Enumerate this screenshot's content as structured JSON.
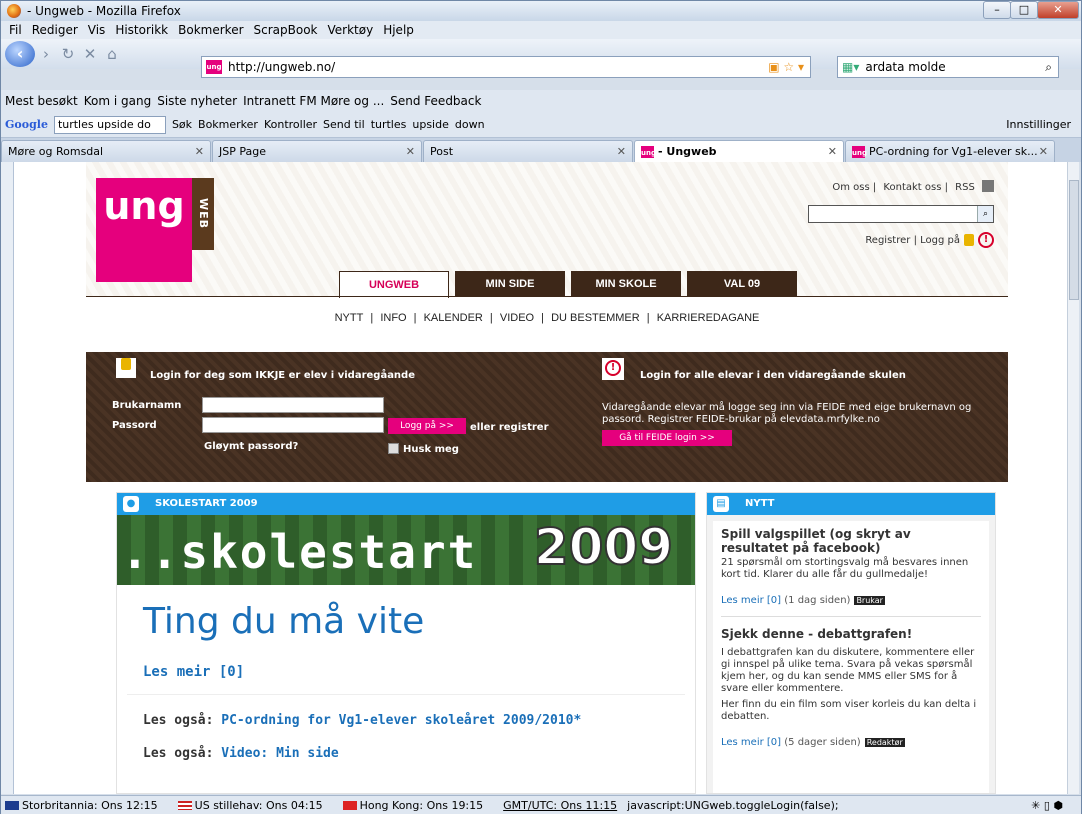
{
  "window": {
    "title": "- Ungweb - Mozilla Firefox"
  },
  "menu": [
    "Fil",
    "Rediger",
    "Vis",
    "Historikk",
    "Bokmerker",
    "ScrapBook",
    "Verktøy",
    "Hjelp"
  ],
  "url": "http://ungweb.no/",
  "search": {
    "value": "ardata molde"
  },
  "bookmarks": [
    "Mest besøkt",
    "Kom i gang",
    "Siste nyheter",
    "Intranett FM Møre og ...",
    "Send Feedback"
  ],
  "googlebar": {
    "logo": "Google",
    "query": "turtles upside do",
    "items": [
      "Søk",
      "Bokmerker",
      "Kontroller",
      "Send til",
      "turtles",
      "upside",
      "down"
    ],
    "settings": "Innstillinger"
  },
  "tabs": [
    {
      "label": "Møre og Romsdal",
      "active": false
    },
    {
      "label": "JSP Page",
      "active": false
    },
    {
      "label": "Post",
      "active": false
    },
    {
      "label": "- Ungweb",
      "active": true
    },
    {
      "label": "PC-ordning for Vg1-elever sk...",
      "active": false
    }
  ],
  "site": {
    "logo": "ung",
    "logo_side": "WEB",
    "toplinks": [
      "Om oss",
      "Kontakt oss",
      "RSS"
    ],
    "register": "Registrer",
    "login": "Logg på",
    "main_tabs": [
      "UNGWEB",
      "MIN SIDE",
      "MIN SKOLE",
      "VAL 09"
    ],
    "subnav": [
      "NYTT",
      "INFO",
      "KALENDER",
      "VIDEO",
      "DU BESTEMMER",
      "KARRIEREDAGANE"
    ],
    "login_left": {
      "title": "Login for deg som IKKJE er elev i vidaregåande",
      "user_label": "Brukarnamn",
      "pass_label": "Passord",
      "button": "Logg på >>",
      "or_register": "eller registrer",
      "forgot": "Gløymt passord?",
      "remember": "Husk meg"
    },
    "login_right": {
      "title": "Login for alle elevar i den vidaregåande skulen",
      "text": "Vidaregåande elevar må logge seg inn via FEIDE med eige brukernavn og passord. Registrer FEIDE-brukar på elevdata.mrfylke.no",
      "button": "Gå til FEIDE login >>"
    },
    "section": {
      "title": "SKOLESTART 2009",
      "banner_text": "..skolestart",
      "banner_year": "2009",
      "heading": "Ting du må vite",
      "read_more": "Les meir [0]",
      "also_label": "Les også:",
      "also": [
        "PC-ordning for Vg1-elever skoleåret 2009/2010*",
        "Video: Min side"
      ]
    },
    "news": {
      "title": "NYTT",
      "items": [
        {
          "title": "Spill valgspillet (og skryt av resultatet på facebook)",
          "body": "21 spørsmål om stortingsvalg må besvares innen kort tid. Klarer du alle får du gullmedalje!",
          "more": "Les meir [0]",
          "when": "(1 dag siden)",
          "tag": "Brukar"
        },
        {
          "title": "Sjekk denne - debattgrafen!",
          "body": "I debattgrafen kan du diskutere, kommentere eller gi innspel på ulike tema. Svara på vekas spørsmål kjem her, og du kan sende MMS eller SMS for å svare eller kommentere.",
          "body2": "Her finn du ein film som viser korleis du kan delta i debatten.",
          "more": "Les meir [0]",
          "when": "(5 dager siden)",
          "tag": "Redaktør"
        }
      ]
    }
  },
  "status": {
    "clocks": [
      "Storbritannia: Ons 12:15",
      "US stillehav: Ons 04:15",
      "Hong Kong: Ons 19:15",
      "GMT/UTC: Ons 11:15"
    ],
    "link": "javascript:UNGweb.toggleLogin(false);"
  }
}
